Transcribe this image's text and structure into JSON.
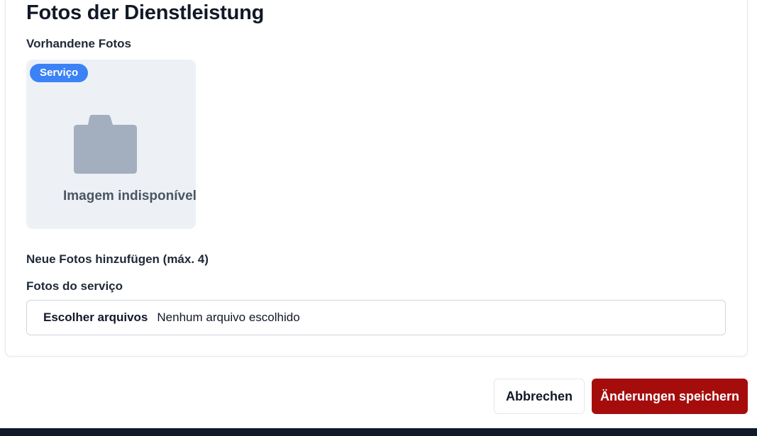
{
  "section": {
    "title": "Fotos der Dienstleistung",
    "existing_label": "Vorhandene Fotos",
    "new_label": "Neue Fotos hinzufügen (máx. 4)",
    "field_label": "Fotos do serviço"
  },
  "photos": [
    {
      "badge": "Serviço",
      "placeholder_text": "Imagem indisponível",
      "icon": "camera-icon"
    }
  ],
  "file_input": {
    "button_label": "Escolher arquivos",
    "status": "Nenhum arquivo escolhido"
  },
  "actions": {
    "cancel_label": "Abbrechen",
    "save_label": "Änderungen speichern"
  },
  "colors": {
    "badge": "#3b82f6",
    "save_button": "#a50d0d",
    "tile_background": "#edf1f6",
    "camera_icon": "#a3afbf",
    "footer": "#0f1a2b"
  }
}
